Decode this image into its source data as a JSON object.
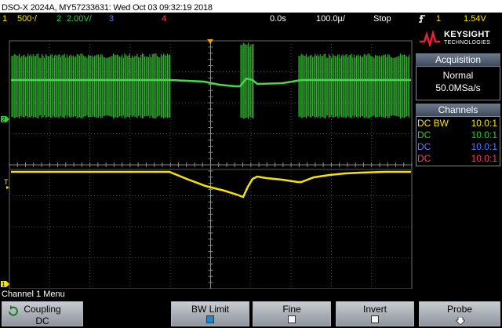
{
  "header": {
    "title": "DSO-X 2024A, MY57233631: Wed Oct 03 09:32:19 2018"
  },
  "status": {
    "ch1_num": "1",
    "ch1_scale": "500‧/",
    "ch2_num": "2",
    "ch2_scale": "2.00V/",
    "ch3_num": "3",
    "ch4_num": "4",
    "time_offset": "0.0s",
    "time_scale": "100.0µ/",
    "run_state": "Stop",
    "trigger_symbol": "∈",
    "trigger_ch": "1",
    "trigger_level": "1.54V"
  },
  "markers": {
    "ch2_marker": "2",
    "trig_marker": "T",
    "ch1_marker": "1"
  },
  "brand": {
    "name": "KEYSIGHT",
    "sub": "TECHNOLOGIES"
  },
  "acquisition": {
    "title": "Acquisition",
    "mode": "Normal",
    "rate": "50.0MSa/s"
  },
  "channels": {
    "title": "Channels",
    "rows": [
      {
        "coupling": "DC BW",
        "ratio": "10.0:1",
        "color": "#f5e400"
      },
      {
        "coupling": "DC",
        "ratio": "10.0:1",
        "color": "#33cc33"
      },
      {
        "coupling": "DC",
        "ratio": "10.0:1",
        "color": "#5a78ff"
      },
      {
        "coupling": "DC",
        "ratio": "10.0:1",
        "color": "#ff3a6a"
      }
    ]
  },
  "menu": {
    "title": "Channel 1 Menu",
    "coupling_label": "Coupling",
    "coupling_value": "DC",
    "bwlimit_label": "BW Limit",
    "bwlimit_on": true,
    "fine_label": "Fine",
    "fine_on": false,
    "invert_label": "Invert",
    "invert_on": false,
    "probe_label": "Probe"
  },
  "colors": {
    "ch1": "#f5e400",
    "ch2": "#33cc33",
    "ch3": "#5a78ff",
    "ch4": "#ff3a6a",
    "trigger": "#ff9900"
  }
}
